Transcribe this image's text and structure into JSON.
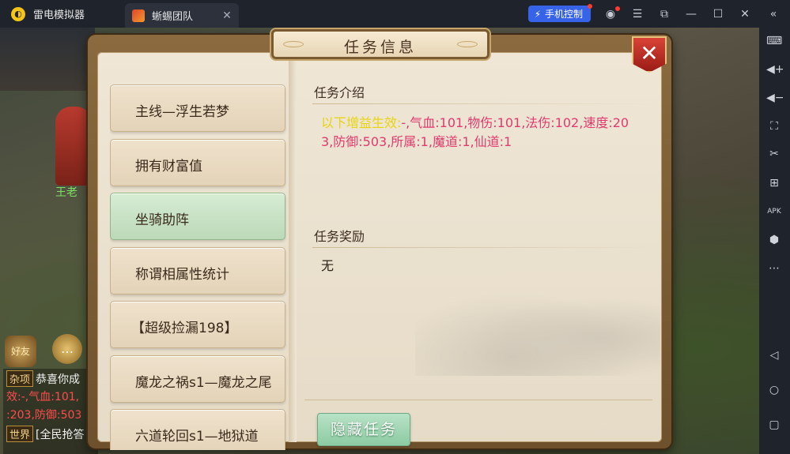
{
  "emulator": {
    "app_name": "雷电模拟器",
    "tab_title": "蜥蜴团队",
    "phone_control_label": "手机控制"
  },
  "game": {
    "npc_name": "王老",
    "friend_label": "好友",
    "chat": [
      {
        "tag": "杂项",
        "text": "恭喜你成"
      },
      {
        "tag": "",
        "text": "效:-,气血:101,"
      },
      {
        "tag": "",
        "text": ":203,防御:503"
      },
      {
        "tag": "世界",
        "text": "[全民抢答"
      }
    ]
  },
  "dialog": {
    "title": "任务信息",
    "tasks": [
      {
        "label": "主线—浮生若梦",
        "active": false
      },
      {
        "label": "拥有财富值",
        "active": false
      },
      {
        "label": "坐骑助阵",
        "active": true
      },
      {
        "label": "称谓相属性统计",
        "active": false
      },
      {
        "label": "【超级捡漏198】",
        "active": false
      },
      {
        "label": "魔龙之祸s1—魔龙之尾",
        "active": false
      },
      {
        "label": "六道轮回s1—地狱道",
        "active": false
      }
    ],
    "intro_heading": "任务介绍",
    "intro_prefix": "以下增益生效:",
    "intro_body": "-,气血:101,物伤:101,法伤:102,速度:203,防御:503,所属:1,魔道:1,仙道:1",
    "reward_heading": "任务奖励",
    "reward_text": "无",
    "hide_button": "隐藏任务"
  },
  "colors": {
    "intro_prefix": "#e8d40c",
    "intro_body": "#e03a6e",
    "active_task": "#bcd9b8",
    "close_button": "#c2322a",
    "phone_control": "#3763e8"
  },
  "icons": {
    "titlebar": [
      "app-logo-icon",
      "tab-close-icon",
      "lightning-icon",
      "user-icon",
      "menu-icon",
      "restore-window-icon",
      "minimize-icon",
      "maximize-icon",
      "close-window-icon",
      "collapse-sidebar-icon"
    ],
    "sidebar": [
      "keyboard-icon",
      "volume-up-icon",
      "volume-down-icon",
      "fullscreen-icon",
      "scissors-icon",
      "add-screen-icon",
      "apk-install-icon",
      "settings-hex-icon",
      "more-icon",
      "back-nav-icon",
      "home-nav-icon",
      "recent-apps-icon"
    ]
  }
}
